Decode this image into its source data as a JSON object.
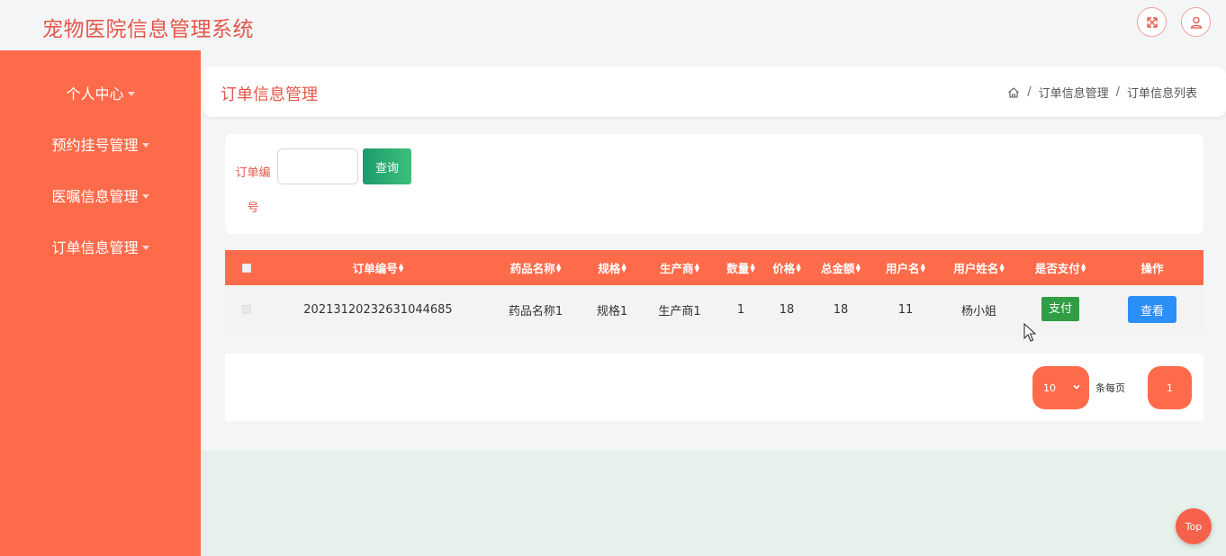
{
  "app": {
    "title": "宠物医院信息管理系统"
  },
  "topbar": {
    "fullscreen_icon": "expand-icon",
    "user_icon": "user-icon"
  },
  "sidebar": {
    "items": [
      {
        "label": "个人中心"
      },
      {
        "label": "预约挂号管理"
      },
      {
        "label": "医嘱信息管理"
      },
      {
        "label": "订单信息管理"
      }
    ]
  },
  "header": {
    "title": "订单信息管理",
    "breadcrumb": [
      "订单信息管理",
      "订单信息列表"
    ]
  },
  "search": {
    "label": "订单编号",
    "value": "",
    "button_label": "查询"
  },
  "table": {
    "columns": [
      "订单编号",
      "药品名称",
      "规格",
      "生产商",
      "数量",
      "价格",
      "总金额",
      "用户名",
      "用户姓名",
      "是否支付",
      "操作"
    ],
    "rows": [
      {
        "order_no": "20213120232631044685",
        "drug_name": "药品名称1",
        "spec": "规格1",
        "manufacturer": "生产商1",
        "quantity": "1",
        "price": "18",
        "total": "18",
        "username": "11",
        "user_fullname": "杨小姐",
        "pay_label": "支付",
        "view_label": "查看"
      }
    ]
  },
  "pagination": {
    "page_size": "10",
    "per_page_label": "条每页",
    "current_page": "1"
  },
  "fab": {
    "label": "Top"
  },
  "colors": {
    "primary": "#fe6b4a",
    "title": "#e4584a",
    "pay": "#2f9e44",
    "view": "#2a8ff7",
    "search": "#1c9b6d"
  }
}
